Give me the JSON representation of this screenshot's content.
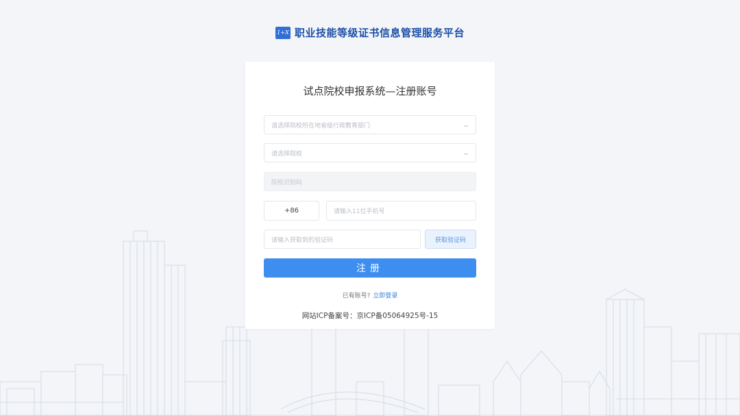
{
  "header": {
    "logo_text": "1+X",
    "site_title": "职业技能等级证书信息管理服务平台"
  },
  "form": {
    "title": "试点院校申报系统—注册账号",
    "province_select_placeholder": "请选择院校所在地省级行政教育部门",
    "school_select_placeholder": "请选择院校",
    "school_code_placeholder": "院校识别码",
    "country_code": "+86",
    "phone_placeholder": "请输入11位手机号",
    "verification_placeholder": "请输入获取到的验证码",
    "get_code_label": "获取验证码",
    "register_label": "注册",
    "have_account_text": "已有账号?",
    "login_link_label": "立即登录",
    "icp_text": "网站ICP备案号：京ICP备05064925号-15"
  },
  "colors": {
    "brand_blue": "#3e8ef0",
    "title_blue": "#1c4fa8",
    "background": "#f3f5f8"
  },
  "icons": {
    "logo": "logo-icon",
    "chevron": "chevron-down-icon"
  }
}
